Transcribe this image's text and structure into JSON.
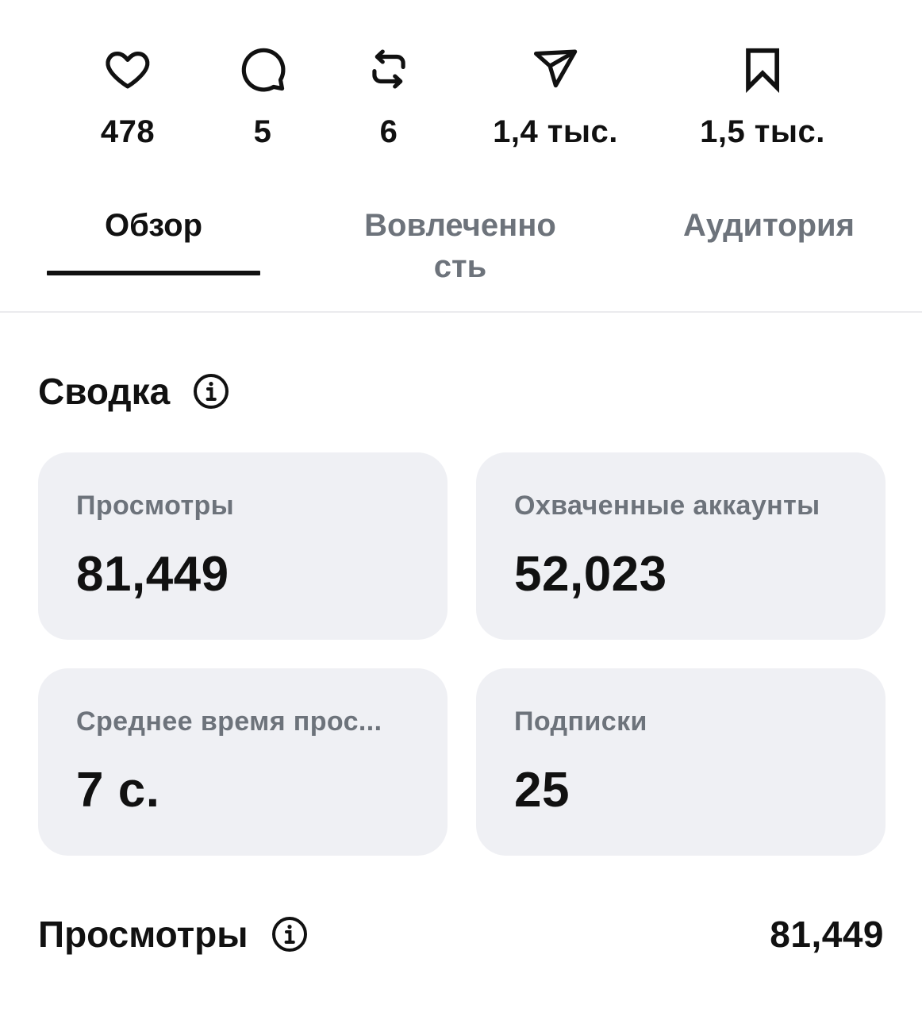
{
  "stats": [
    {
      "icon": "heart-icon",
      "count": "478"
    },
    {
      "icon": "comment-icon",
      "count": "5"
    },
    {
      "icon": "repost-icon",
      "count": "6"
    },
    {
      "icon": "share-icon",
      "count": "1,4 тыс."
    },
    {
      "icon": "bookmark-icon",
      "count": "1,5 тыс."
    }
  ],
  "tabs": [
    {
      "label": "Обзор",
      "active": true
    },
    {
      "label_line1": "Вовлеченно",
      "label_line2": "сть",
      "active": false
    },
    {
      "label": "Аудитория",
      "active": false
    }
  ],
  "summary": {
    "title": "Сводка",
    "cards": [
      {
        "label": "Просмотры",
        "value": "81,449"
      },
      {
        "label": "Охваченные аккаунты",
        "value": "52,023"
      },
      {
        "label": "Среднее время прос...",
        "value": "7 с."
      },
      {
        "label": "Подписки",
        "value": "25"
      }
    ]
  },
  "views": {
    "title": "Просмотры",
    "total": "81,449"
  },
  "colors": {
    "text": "#111111",
    "muted": "#6d737b",
    "card_bg": "#eff0f4",
    "divider": "#ebebee"
  }
}
